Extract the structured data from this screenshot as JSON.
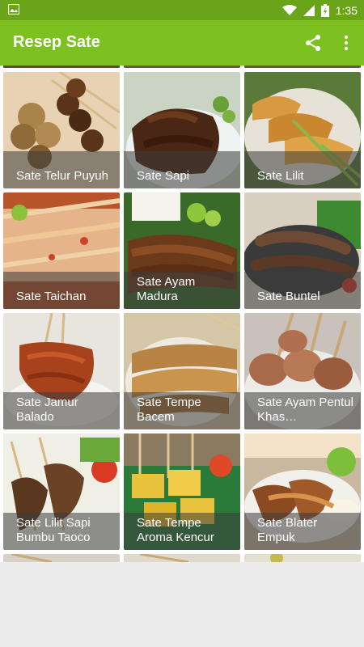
{
  "status_bar": {
    "time": "1:35",
    "icons": [
      "image-icon",
      "wifi-icon",
      "signal-icon",
      "battery-icon"
    ]
  },
  "app_bar": {
    "title": "Resep Sate",
    "actions": [
      "share-icon",
      "more-vert-icon"
    ]
  },
  "colors": {
    "status_bar": "#6aa519",
    "app_bar": "#7cc11f",
    "caption_overlay": "rgba(60,60,60,0.55)"
  },
  "grid": {
    "items": [
      {
        "label": "Sate Telur Puyuh"
      },
      {
        "label": "Sate Sapi"
      },
      {
        "label": "Sate Lilit"
      },
      {
        "label": "Sate Taichan"
      },
      {
        "label": "Sate Ayam Madura"
      },
      {
        "label": "Sate Buntel"
      },
      {
        "label": "Sate Jamur Balado"
      },
      {
        "label": "Sate Tempe Bacem"
      },
      {
        "label": "Sate Ayam Pentul Khas…"
      },
      {
        "label": "Sate Lilit Sapi Bumbu Taoco"
      },
      {
        "label": "Sate Tempe Aroma Kencur"
      },
      {
        "label": "Sate Blater Empuk"
      }
    ]
  }
}
